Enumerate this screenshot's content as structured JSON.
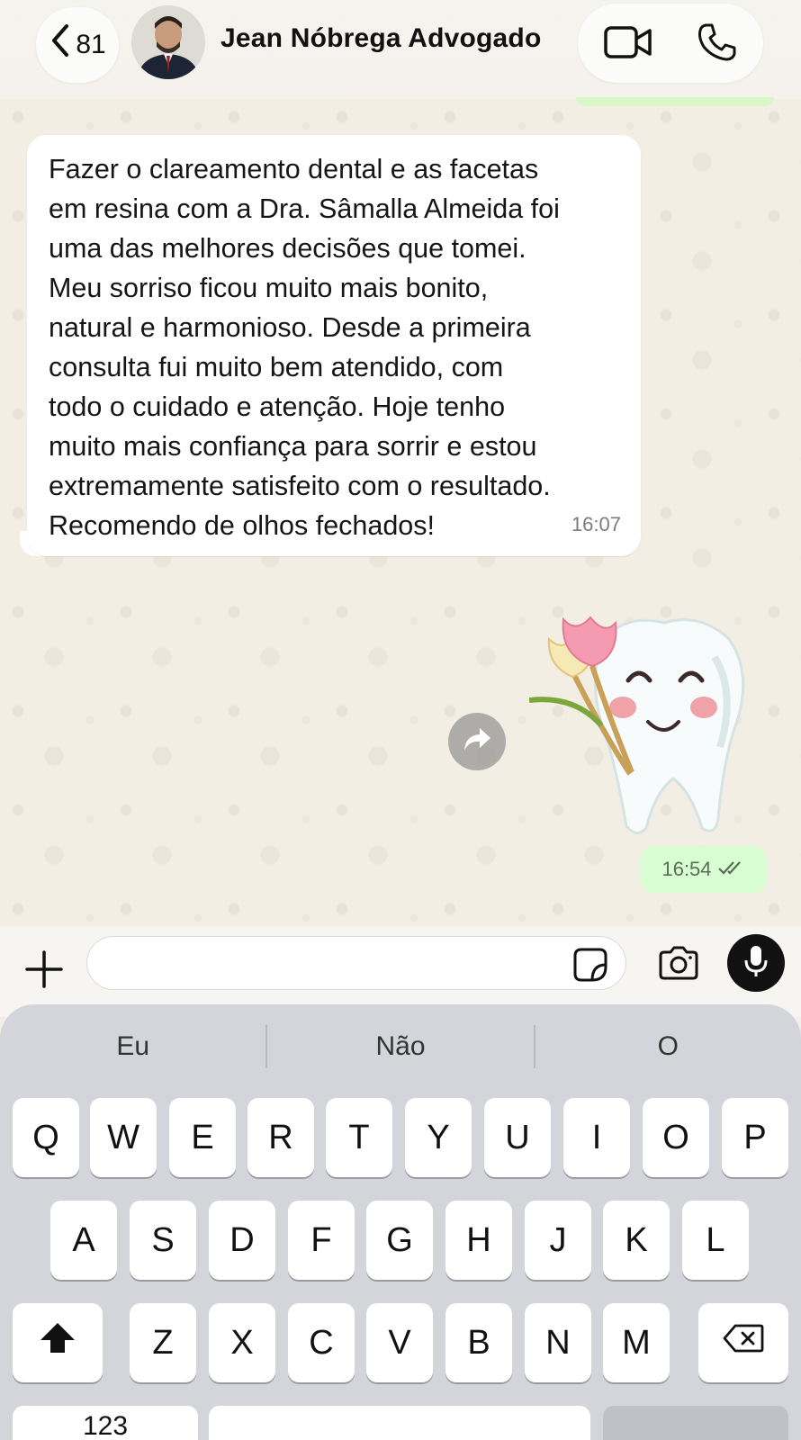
{
  "header": {
    "back_label": "<",
    "unread_count": "81",
    "contact_name": "Jean Nóbrega Advogado",
    "video_icon": "video-camera-icon",
    "phone_icon": "phone-icon"
  },
  "messages": {
    "incoming_text": "Fazer o clareamento dental e as facetas\nem resina com a Dra. Sâmalla Almeida foi\numa das melhores decisões que tomei.\nMeu sorriso ficou muito mais bonito,\nnatural e harmonioso. Desde a primeira\nconsulta fui muito bem atendido, com\ntodo o cuidado e atenção. Hoje tenho\nmuito mais confiança para sorrir e estou\nextremamente satisfeito com o resultado.\nRecomendo de olhos fechados!",
    "incoming_time": "16:07",
    "outgoing_time": "16:54",
    "outgoing_status": "read"
  },
  "input": {
    "value": "",
    "placeholder": ""
  },
  "keyboard": {
    "suggestions": [
      "Eu",
      "Não",
      "O"
    ],
    "row1": [
      "Q",
      "W",
      "E",
      "R",
      "T",
      "Y",
      "U",
      "I",
      "O",
      "P"
    ],
    "row2": [
      "A",
      "S",
      "D",
      "F",
      "G",
      "H",
      "J",
      "K",
      "L"
    ],
    "row3": [
      "Z",
      "X",
      "C",
      "V",
      "B",
      "N",
      "M"
    ],
    "numbers_label": "123"
  },
  "colors": {
    "outgoing_bubble": "#d9fdd3",
    "incoming_bubble": "#ffffff",
    "wallpaper": "#f3eee3",
    "keyboard_bg": "#d4d5da"
  }
}
